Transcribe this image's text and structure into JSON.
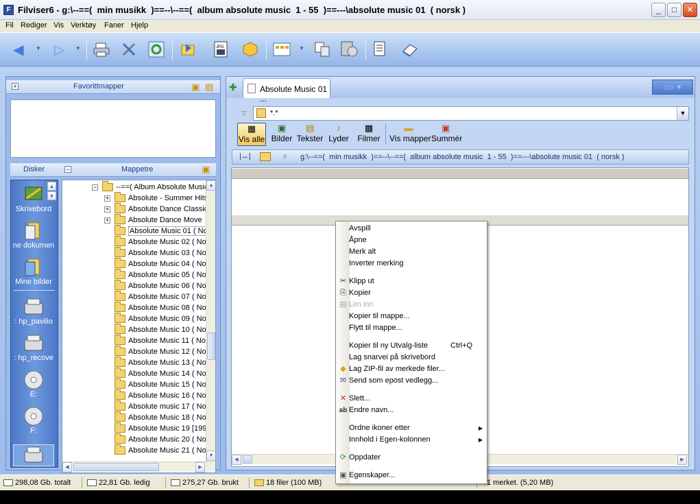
{
  "window": {
    "title": "Filviser6 - g:\\--==(  min musikk  )==--\\--==(  album absolute music  1 - 55  )==---\\absolute music 01  ( norsk )"
  },
  "menu": [
    "Fil",
    "Rediger",
    "Vis",
    "Verktøy",
    "Faner",
    "Hjelp"
  ],
  "toolbar": {
    "icons": [
      "back-arrow-icon",
      "forward-arrow-icon",
      "printer-icon",
      "tools-icon",
      "refresh-icon",
      "folder-move-icon",
      "jpg-icon",
      "package-icon",
      "view-icon",
      "copy-icon",
      "film-disk-icon",
      "report-icon",
      "eraser-icon"
    ]
  },
  "left": {
    "favorites_header": "Favorittmapper",
    "disks_header": "Disker",
    "tree_header": "Mappetre",
    "drives": [
      {
        "label": "Skrivebord",
        "icon": "desktop-icon"
      },
      {
        "label": "ne dokumen",
        "icon": "documents-icon"
      },
      {
        "label": "Mine bilder",
        "icon": "pictures-icon"
      },
      {
        "label": ": hp_pavilio",
        "icon": "hard-drive-icon"
      },
      {
        "label": ": hp_recove",
        "icon": "hard-drive-icon"
      },
      {
        "label": "E:",
        "icon": "cd-drive-icon"
      },
      {
        "label": "F:",
        "icon": "cd-drive-icon"
      }
    ],
    "tree": [
      {
        "label": "--==(  Album Absolute Music",
        "level": 0,
        "expander": "−"
      },
      {
        "label": "Absolute - Summer Hits",
        "level": 1,
        "expander": "+"
      },
      {
        "label": "Absolute Dance Classics",
        "level": 1,
        "expander": "+"
      },
      {
        "label": "Absolute Dance Move",
        "level": 1,
        "expander": "+"
      },
      {
        "label": "Absolute Music 01  ( No",
        "level": 1,
        "expander": ""
      },
      {
        "label": "Absolute Music 02  ( No",
        "level": 1,
        "expander": ""
      },
      {
        "label": "Absolute Music 03  ( No",
        "level": 1,
        "expander": ""
      },
      {
        "label": "Absolute Music 04  ( No",
        "level": 1,
        "expander": ""
      },
      {
        "label": "Absolute Music 05  ( No",
        "level": 1,
        "expander": ""
      },
      {
        "label": "Absolute Music 06  ( No",
        "level": 1,
        "expander": ""
      },
      {
        "label": "Absolute Music 07  ( No",
        "level": 1,
        "expander": ""
      },
      {
        "label": "Absolute Music 08  ( No",
        "level": 1,
        "expander": ""
      },
      {
        "label": "Absolute Music 09  ( No",
        "level": 1,
        "expander": ""
      },
      {
        "label": "Absolute Music 10  ( No",
        "level": 1,
        "expander": ""
      },
      {
        "label": "Absolute Music 11  ( No",
        "level": 1,
        "expander": ""
      },
      {
        "label": "Absolute Music 12  ( No",
        "level": 1,
        "expander": ""
      },
      {
        "label": "Absolute Music 13  ( No",
        "level": 1,
        "expander": ""
      },
      {
        "label": "Absolute Music 14  ( No",
        "level": 1,
        "expander": ""
      },
      {
        "label": "Absolute Music 15  ( No",
        "level": 1,
        "expander": ""
      },
      {
        "label": "Absolute Music 16  ( No",
        "level": 1,
        "expander": ""
      },
      {
        "label": "Absolute music 17  ( No",
        "level": 1,
        "expander": ""
      },
      {
        "label": "Absolute Music 18  ( No",
        "level": 1,
        "expander": ""
      },
      {
        "label": "Absolute Music 19 [199",
        "level": 1,
        "expander": ""
      },
      {
        "label": "Absolute Music 20  ( No",
        "level": 1,
        "expander": ""
      },
      {
        "label": "Absolute Music 21  ( No",
        "level": 1,
        "expander": ""
      }
    ]
  },
  "right": {
    "tab_label": "Absolute Music 01 ...",
    "filter_value": "*.*",
    "type_buttons": [
      "Vis alle",
      "Bilder",
      "Tekster",
      "Lyder",
      "Filmer",
      "Vis mapper",
      "Summér"
    ],
    "path": "g:\\--==(  min musikk  )==--\\--==(  album absolute music  1 - 55  )==---\\absolute music 01  ( norsk )"
  },
  "context_menu": {
    "items": [
      {
        "label": "Avspill",
        "icon": "",
        "disabled": false,
        "shortcut": "",
        "submenu": false
      },
      {
        "label": "Åpne",
        "icon": "",
        "disabled": false,
        "shortcut": "",
        "submenu": false
      },
      {
        "label": "Merk alt",
        "icon": "",
        "disabled": false,
        "shortcut": "",
        "submenu": false
      },
      {
        "label": "Inverter merking",
        "icon": "",
        "disabled": false,
        "shortcut": "",
        "submenu": false
      },
      {
        "sep": true
      },
      {
        "label": "Klipp ut",
        "icon": "scissors-icon",
        "disabled": false,
        "shortcut": "",
        "submenu": false
      },
      {
        "label": "Kopier",
        "icon": "copy-icon",
        "disabled": false,
        "shortcut": "",
        "submenu": false
      },
      {
        "label": "Lim inn",
        "icon": "paste-icon",
        "disabled": true,
        "shortcut": "",
        "submenu": false
      },
      {
        "label": "Kopier til mappe...",
        "icon": "",
        "disabled": false,
        "shortcut": "",
        "submenu": false
      },
      {
        "label": "Flytt til mappe...",
        "icon": "",
        "disabled": false,
        "shortcut": "",
        "submenu": false
      },
      {
        "sep": true
      },
      {
        "label": "Kopier til ny Utvalg-liste",
        "icon": "",
        "disabled": false,
        "shortcut": "Ctrl+Q",
        "submenu": false
      },
      {
        "label": "Lag snarvei på skrivebord",
        "icon": "",
        "disabled": false,
        "shortcut": "",
        "submenu": false
      },
      {
        "label": "Lag ZIP-fil av merkede filer...",
        "icon": "zip-icon",
        "disabled": false,
        "shortcut": "",
        "submenu": false
      },
      {
        "label": "Send som epost vedlegg...",
        "icon": "email-icon",
        "disabled": false,
        "shortcut": "",
        "submenu": false
      },
      {
        "sep": true
      },
      {
        "label": "Slett...",
        "icon": "delete-icon",
        "disabled": false,
        "shortcut": "",
        "submenu": false
      },
      {
        "label": "Endre navn...",
        "icon": "rename-icon",
        "disabled": false,
        "shortcut": "",
        "submenu": false
      },
      {
        "sep": true
      },
      {
        "label": "Ordne ikoner etter",
        "icon": "",
        "disabled": false,
        "shortcut": "",
        "submenu": true
      },
      {
        "label": "Innhold i Egen-kolonnen",
        "icon": "",
        "disabled": false,
        "shortcut": "",
        "submenu": true
      },
      {
        "sep": true
      },
      {
        "label": "Oppdater",
        "icon": "refresh-icon",
        "disabled": false,
        "shortcut": "",
        "submenu": false
      },
      {
        "sep": true
      },
      {
        "label": "Egenskaper...",
        "icon": "properties-icon",
        "disabled": false,
        "shortcut": "",
        "submenu": false
      }
    ]
  },
  "status": {
    "total": "298,08 Gb. totalt",
    "free": "22,81 Gb. ledig",
    "used": "275,27 Gb. brukt",
    "files": "18 filer (100 MB)",
    "selected": "1 merket. (5,20 MB)"
  }
}
